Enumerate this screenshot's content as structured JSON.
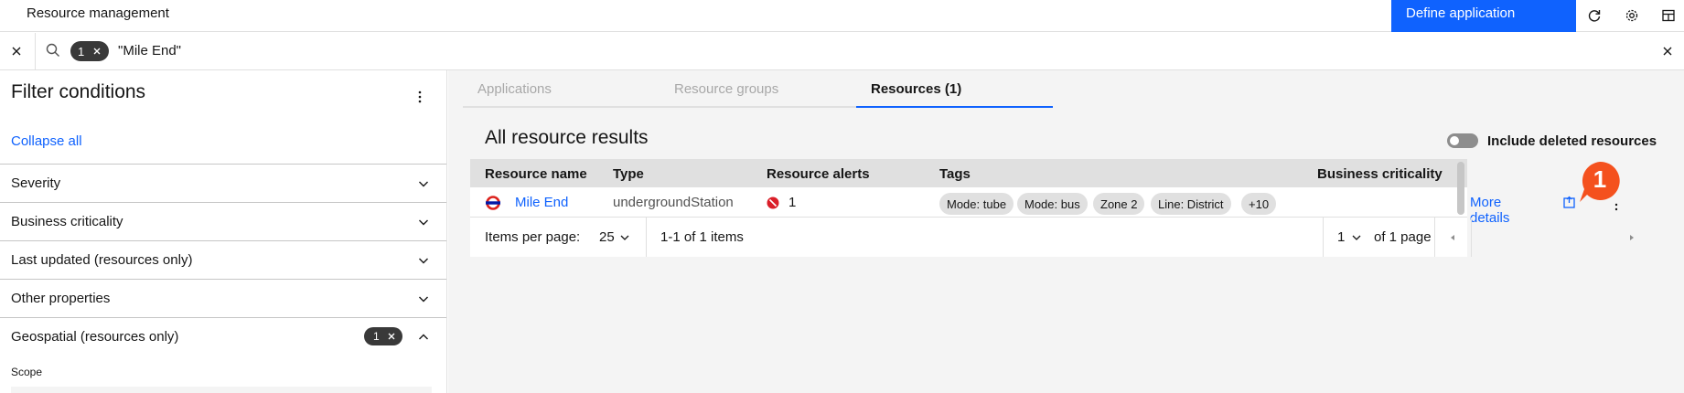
{
  "header": {
    "app_title": "Resource management",
    "define_button": "Define application",
    "icons": [
      "refresh-icon",
      "settings-icon",
      "layout-icon"
    ]
  },
  "search": {
    "tag_count": "1",
    "query": "\"Mile End\""
  },
  "filters": {
    "title": "Filter conditions",
    "collapse_all": "Collapse all",
    "items": [
      {
        "label": "Severity"
      },
      {
        "label": "Business criticality"
      },
      {
        "label": "Last updated (resources only)"
      },
      {
        "label": "Other properties"
      },
      {
        "label": "Geospatial (resources only)",
        "badge": "1",
        "expanded": true
      }
    ],
    "scope_label": "Scope"
  },
  "tabs": [
    {
      "label": "Applications",
      "state": "disabled"
    },
    {
      "label": "Resource groups",
      "state": "disabled"
    },
    {
      "label": "Resources (1)",
      "state": "active"
    }
  ],
  "results": {
    "title": "All resource results",
    "include_deleted_label": "Include deleted resources",
    "include_deleted": false,
    "columns": [
      "Resource name",
      "Type",
      "Resource alerts",
      "Tags",
      "Business criticality"
    ],
    "rows": [
      {
        "name": "Mile End",
        "type": "undergroundStation",
        "alerts": "1",
        "tags": [
          "Mode: tube",
          "Mode: bus",
          "Zone 2",
          "Line: District",
          "+10"
        ],
        "action": "More details"
      }
    ]
  },
  "pagination": {
    "items_per_page_label": "Items per page:",
    "items_per_page": "25",
    "range": "1-1 of 1 items",
    "page": "1",
    "of_pages": "of 1 page"
  },
  "callout": {
    "number": "1",
    "color": "#f4511e"
  },
  "colors": {
    "accent": "#0f62fe",
    "alert": "#da1e28",
    "tube_logo": "#dc241f"
  }
}
